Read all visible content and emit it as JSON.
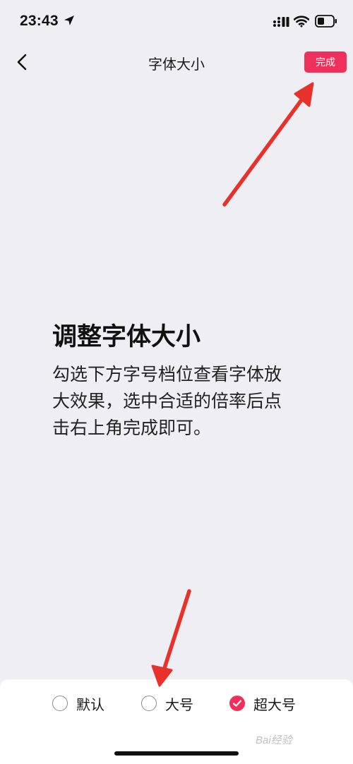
{
  "status_bar": {
    "time": "23:43",
    "icons": [
      "location-arrow-icon",
      "cellular-signal-icon",
      "wifi-icon",
      "battery-icon"
    ]
  },
  "nav": {
    "title": "字体大小",
    "done_label": "完成",
    "back_icon": "chevron-left-icon"
  },
  "preview": {
    "heading": "调整字体大小",
    "body_lines": [
      "勾选下方字号档位查看字体放",
      "大效果，选中合适的倍率后点",
      "击右上角完成即可。"
    ]
  },
  "font_size_options": [
    {
      "label": "默认",
      "selected": false
    },
    {
      "label": "大号",
      "selected": false
    },
    {
      "label": "超大号",
      "selected": true
    }
  ],
  "watermark": "Bai经验",
  "colors": {
    "accent": "#f0305c",
    "background": "#efeef2",
    "panel": "#ffffff",
    "annotation_arrow": "#e8312a"
  }
}
